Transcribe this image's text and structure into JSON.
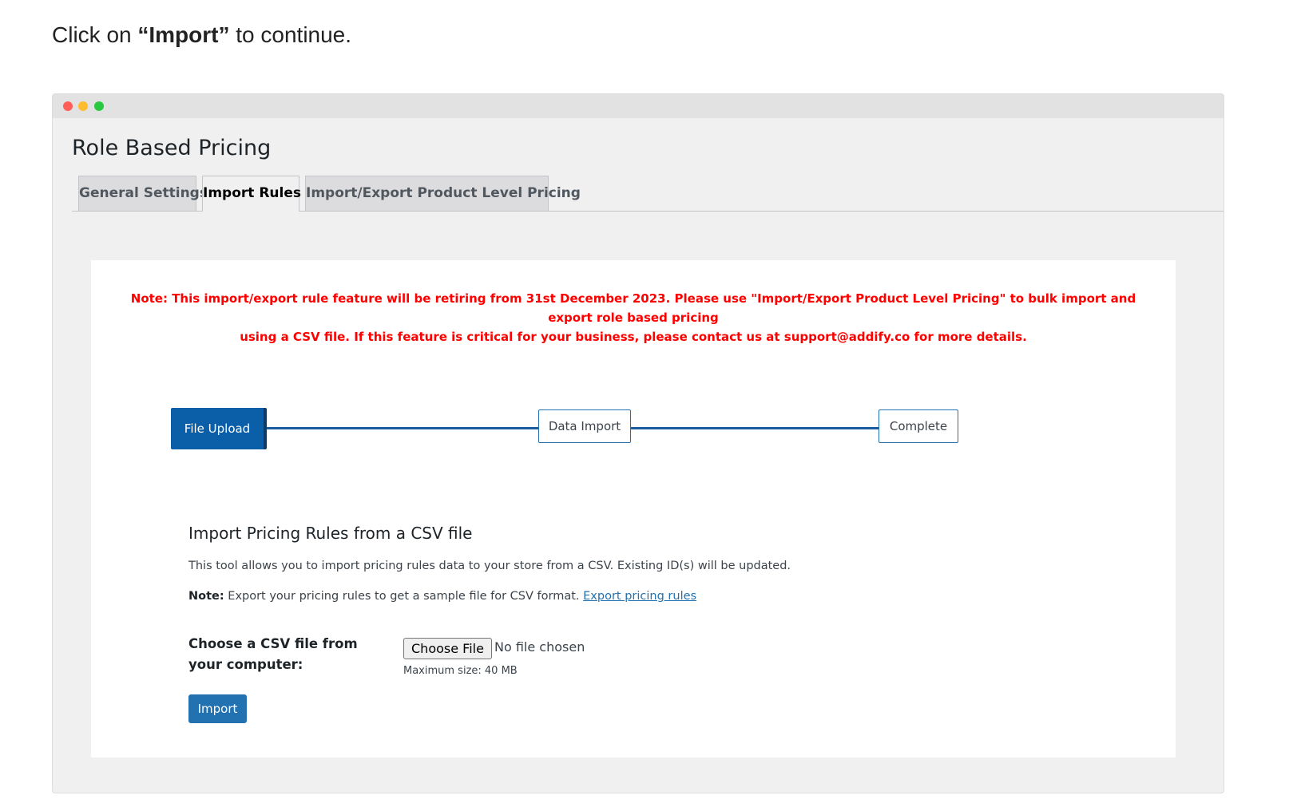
{
  "intro": {
    "prefix": "Click on ",
    "emphasis": "“Import”",
    "suffix": " to continue."
  },
  "window": {
    "page_title": "Role Based Pricing",
    "tabs": [
      {
        "label": "General Settings",
        "active": false
      },
      {
        "label": "Import Rules",
        "active": true
      },
      {
        "label": "Import/Export Product Level Pricing",
        "active": false
      }
    ]
  },
  "panel": {
    "notice_line1": "Note: This import/export rule feature will be retiring from 31st December 2023. Please use \"Import/Export Product Level Pricing\" to bulk import and export role based pricing",
    "notice_line2": "using a CSV file. If this feature is critical for your business, please contact us at support@addify.co for more details.",
    "steps": [
      {
        "label": "File Upload",
        "active": true
      },
      {
        "label": "Data Import",
        "active": false
      },
      {
        "label": "Complete",
        "active": false
      }
    ],
    "section_title": "Import Pricing Rules from a CSV file",
    "description": "This tool allows you to import pricing rules data to your store from a CSV. Existing ID(s) will be updated.",
    "note_label": "Note:",
    "note_text": " Export your pricing rules to get a sample file for CSV format. ",
    "note_link": "Export pricing rules",
    "file_label": "Choose a CSV file from your computer:",
    "choose_file_button": "Choose File",
    "file_status": "No file chosen",
    "max_size": "Maximum size: 40 MB",
    "import_button": "Import"
  },
  "colors": {
    "notice": "#ff0000",
    "primary": "#2271b1",
    "step_active": "#0b5ea8"
  }
}
